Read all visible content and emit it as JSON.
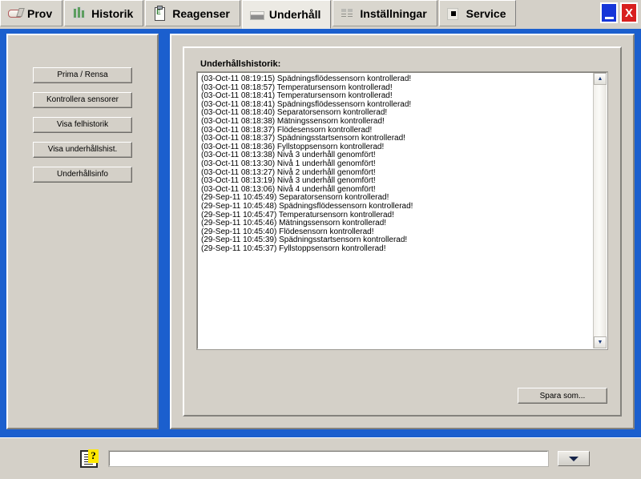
{
  "window": {
    "minimize_label": "_",
    "close_label": "X"
  },
  "tabs": [
    {
      "label": "Prov",
      "icon": "vial-icon",
      "active": false
    },
    {
      "label": "Historik",
      "icon": "bar-chart-icon",
      "active": false
    },
    {
      "label": "Reagenser",
      "icon": "clipboard-icon",
      "active": false
    },
    {
      "label": "Underhåll",
      "icon": "slab-icon",
      "active": true
    },
    {
      "label": "Inställningar",
      "icon": "settings-icon",
      "active": false
    },
    {
      "label": "Service",
      "icon": "service-icon",
      "active": false
    }
  ],
  "sidebar": {
    "buttons": [
      {
        "label": "Prima / Rensa"
      },
      {
        "label": "Kontrollera sensorer"
      },
      {
        "label": "Visa felhistorik"
      },
      {
        "label": "Visa underhållshist."
      },
      {
        "label": "Underhållsinfo"
      }
    ]
  },
  "main": {
    "log_title": "Underhållshistorik:",
    "log_lines": [
      "(03-Oct-11 08:19:15) Spädningsflödessensorn kontrollerad!",
      "(03-Oct-11 08:18:57) Temperatursensorn kontrollerad!",
      "(03-Oct-11 08:18:41) Temperatursensorn kontrollerad!",
      "(03-Oct-11 08:18:41) Spädningsflödessensorn kontrollerad!",
      "(03-Oct-11 08:18:40) Separatorsensorn kontrollerad!",
      "(03-Oct-11 08:18:38) Mätningssensorn kontrollerad!",
      "(03-Oct-11 08:18:37) Flödesensorn kontrollerad!",
      "(03-Oct-11 08:18:37) Spädningsstartsensorn kontrollerad!",
      "(03-Oct-11 08:18:36) Fyllstoppsensorn kontrollerad!",
      "(03-Oct-11 08:13:38) Nivå 3 underhåll genomfört!",
      "(03-Oct-11 08:13:30) Nivå 1 underhåll genomfört!",
      "(03-Oct-11 08:13:27) Nivå 2 underhåll genomfört!",
      "(03-Oct-11 08:13:19) Nivå 3 underhåll genomfört!",
      "(03-Oct-11 08:13:06) Nivå 4 underhåll genomfört!",
      "(29-Sep-11 10:45:49) Separatorsensorn kontrollerad!",
      "(29-Sep-11 10:45:48) Spädningsflödessensorn kontrollerad!",
      "(29-Sep-11 10:45:47) Temperatursensorn kontrollerad!",
      "(29-Sep-11 10:45:46) Mätningssensorn kontrollerad!",
      "(29-Sep-11 10:45:40) Flödesensorn kontrollerad!",
      "(29-Sep-11 10:45:39) Spädningsstartsensorn kontrollerad!",
      "(29-Sep-11 10:45:37) Fyllstoppsensorn kontrollerad!"
    ],
    "scroll_up_label": "▲",
    "scroll_down_label": "▼",
    "save_as_label": "Spara som..."
  },
  "statusbar": {
    "icon": "document-help-icon",
    "question_mark": "?",
    "message": "",
    "message_placeholder": "",
    "dropdown_icon": "chevron-down-icon"
  },
  "colors": {
    "frame_blue": "#1b5fce",
    "face": "#d4d0c8",
    "active_tab": "#eceae4",
    "minimize_blue": "#1636d8",
    "close_red": "#d81f1f",
    "highlight_yellow": "#ffe800"
  }
}
